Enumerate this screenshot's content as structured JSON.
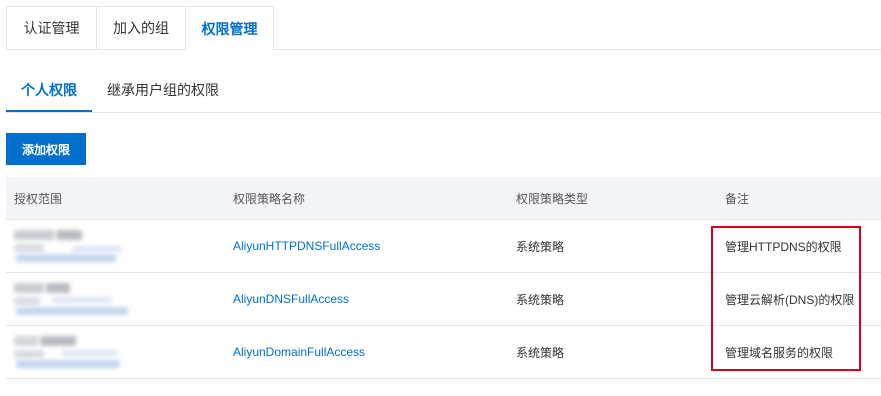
{
  "top_tabs": [
    {
      "label": "认证管理"
    },
    {
      "label": "加入的组"
    },
    {
      "label": "权限管理",
      "active": true
    }
  ],
  "sub_tabs": [
    {
      "label": "个人权限",
      "active": true
    },
    {
      "label": "继承用户组的权限"
    }
  ],
  "add_button": {
    "label": "添加权限"
  },
  "table": {
    "headers": [
      "授权范围",
      "权限策略名称",
      "权限策略类型",
      "备注"
    ],
    "rows": [
      {
        "policy": "AliyunHTTPDNSFullAccess",
        "type": "系统策略",
        "note": "管理HTTPDNS的权限"
      },
      {
        "policy": "AliyunDNSFullAccess",
        "type": "系统策略",
        "note": "管理云解析(DNS)的权限"
      },
      {
        "policy": "AliyunDomainFullAccess",
        "type": "系统策略",
        "note": "管理域名服务的权限"
      }
    ]
  },
  "colors": {
    "accent": "#0070cc",
    "highlight_border": "#d9001b",
    "header_bg": "#f2f4f7"
  }
}
